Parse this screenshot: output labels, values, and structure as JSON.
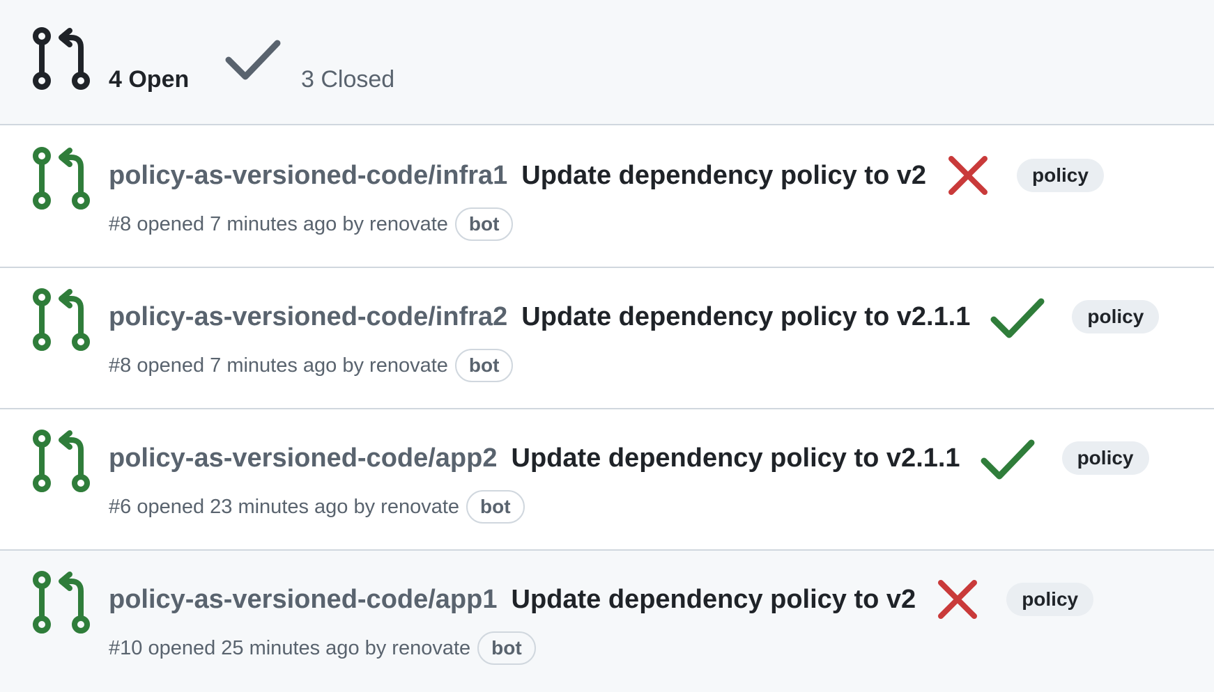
{
  "header": {
    "open_label": "4 Open",
    "closed_label": "3 Closed"
  },
  "colors": {
    "open_green": "#2f7d3a",
    "fail_red": "#c93a3a",
    "success_green": "#2f7d3a",
    "muted": "#59636e"
  },
  "pull_requests": [
    {
      "repo": "policy-as-versioned-code/infra1",
      "title": "Update dependency policy to v2",
      "status": "failure",
      "label": "policy",
      "meta": "#8 opened 7 minutes ago by renovate",
      "author_badge": "bot"
    },
    {
      "repo": "policy-as-versioned-code/infra2",
      "title": "Update dependency policy to v2.1.1",
      "status": "success",
      "label": "policy",
      "meta": "#8 opened 7 minutes ago by renovate",
      "author_badge": "bot"
    },
    {
      "repo": "policy-as-versioned-code/app2",
      "title": "Update dependency policy to v2.1.1",
      "status": "success",
      "label": "policy",
      "meta": "#6 opened 23 minutes ago by renovate",
      "author_badge": "bot"
    },
    {
      "repo": "policy-as-versioned-code/app1",
      "title": "Update dependency policy to v2",
      "status": "failure",
      "label": "policy",
      "meta": "#10 opened 25 minutes ago by renovate",
      "author_badge": "bot"
    }
  ]
}
